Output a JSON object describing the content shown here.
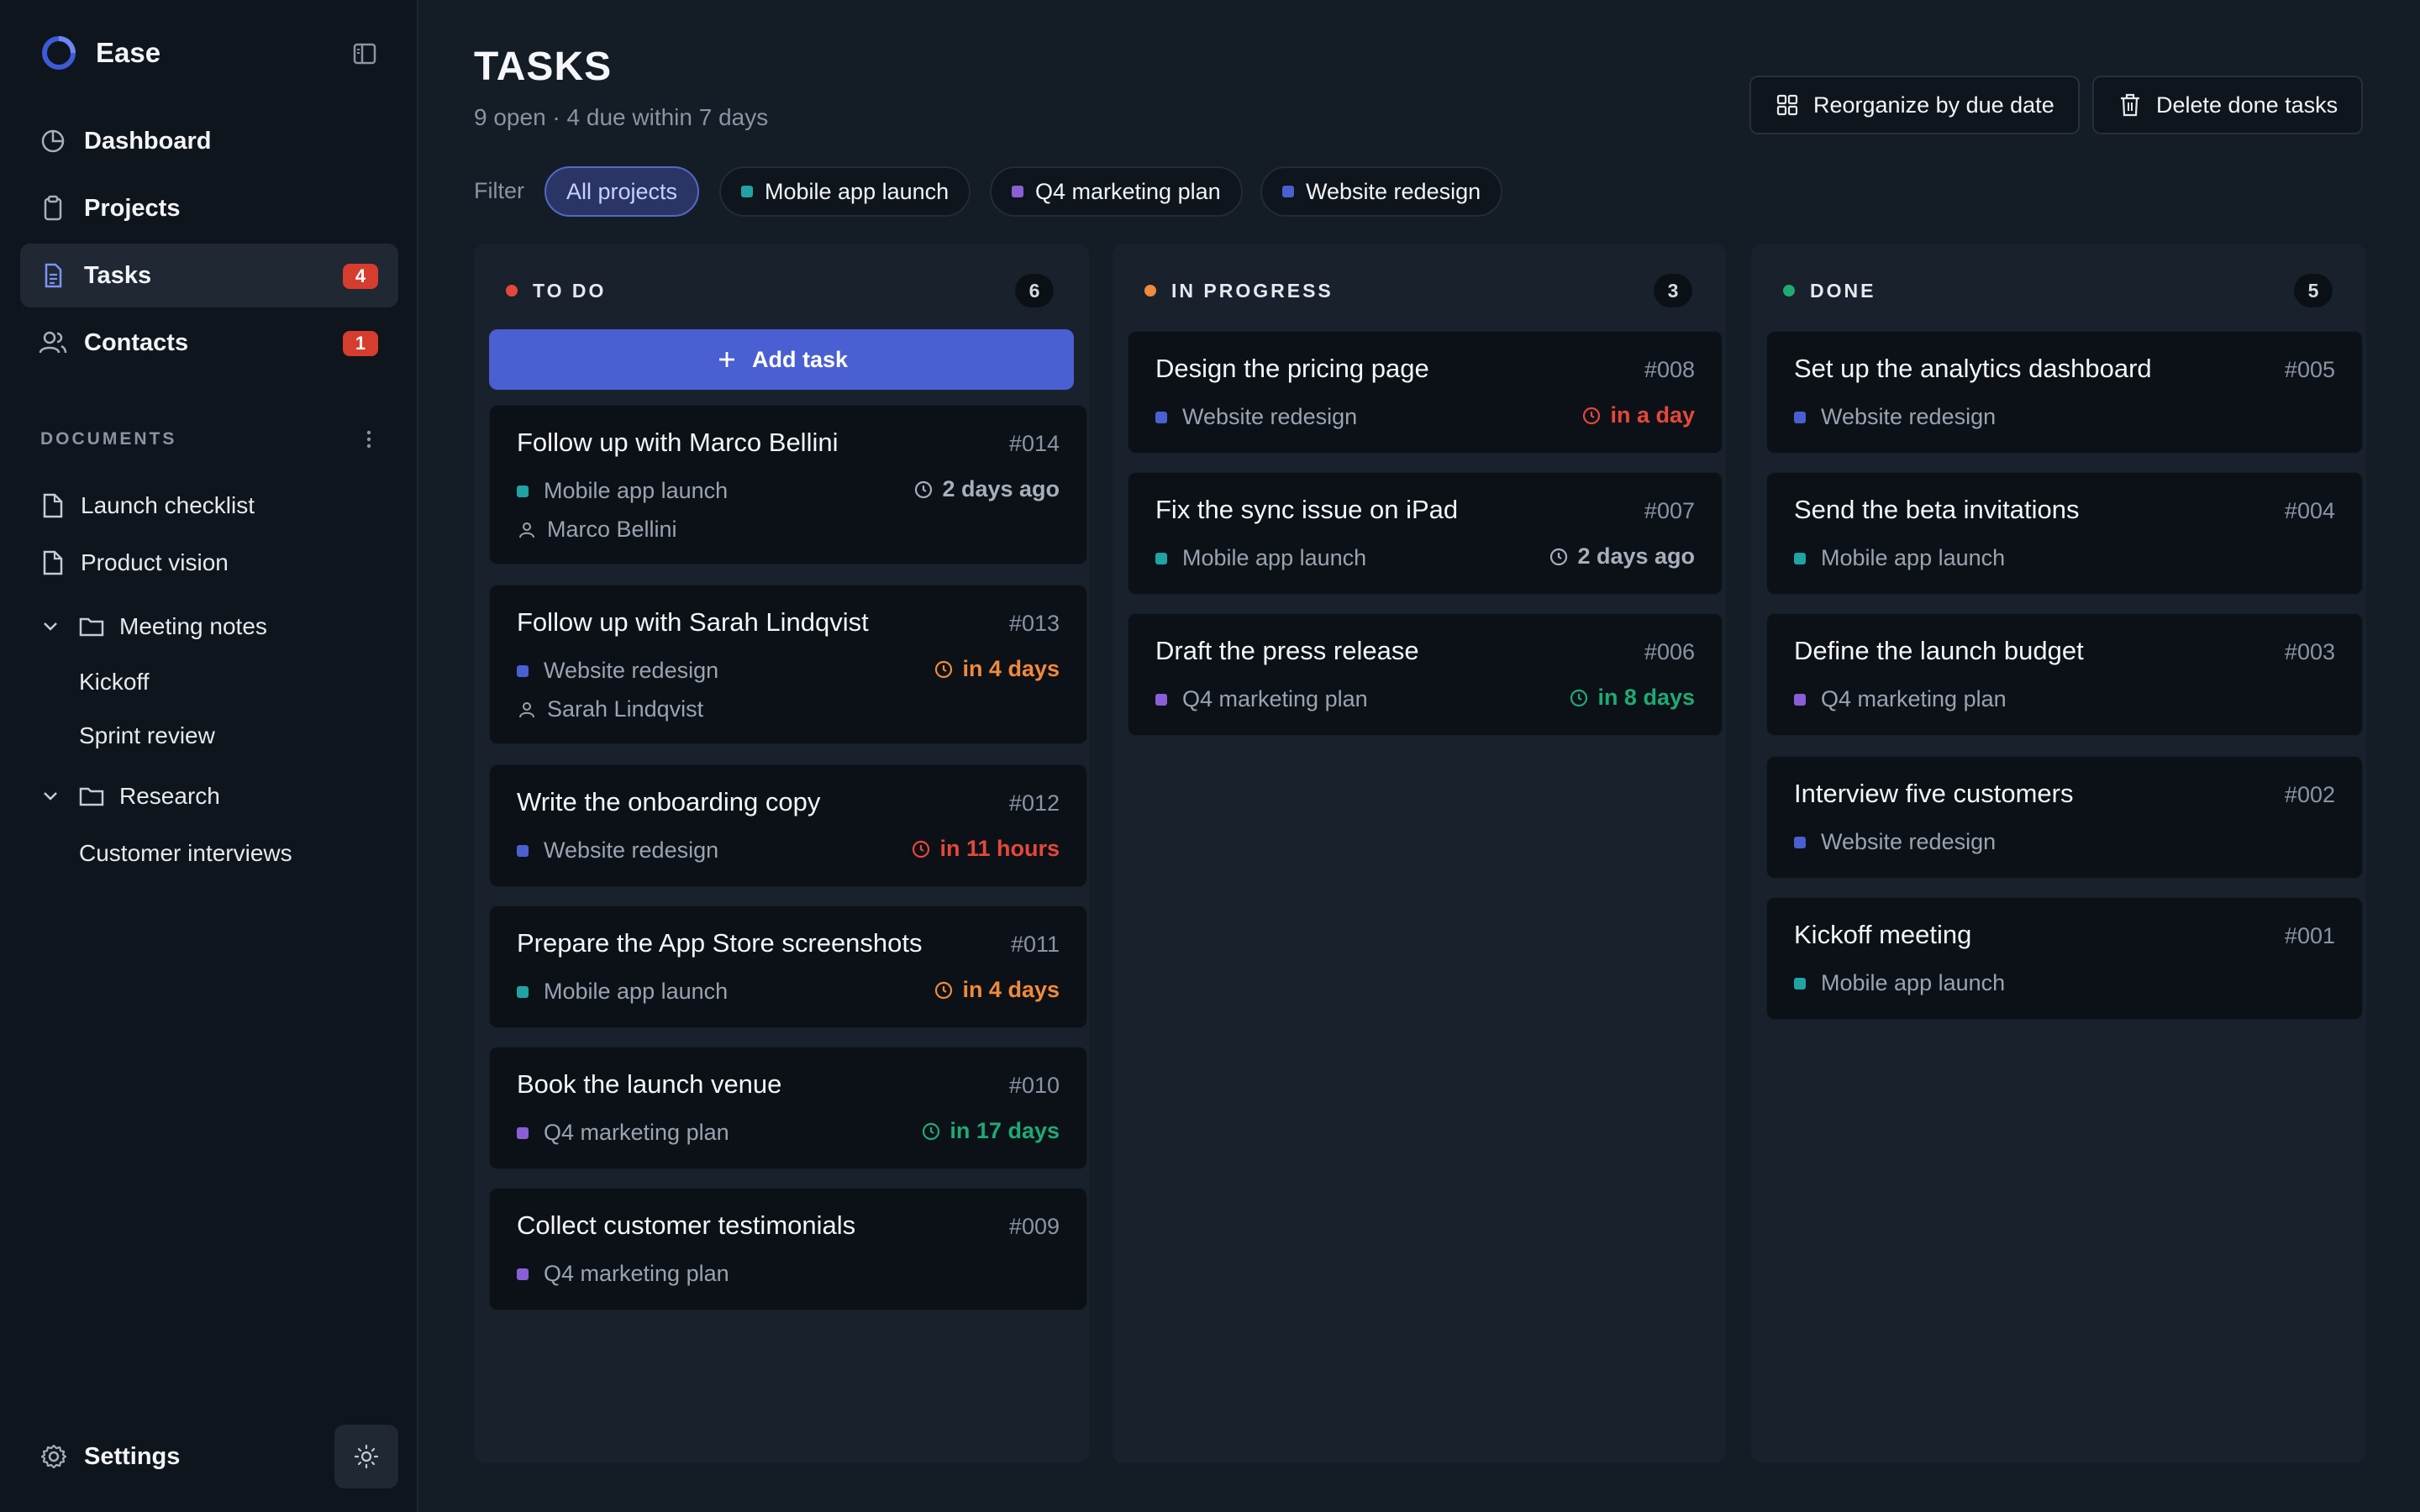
{
  "colors": {
    "teal": "#1fa3a3",
    "purple": "#8a5fd6",
    "blue": "#4a5fd1",
    "red": "#e5483a",
    "orange": "#f08a3c",
    "green": "#1faa74",
    "gray": "#a7afbb"
  },
  "sidebar": {
    "app_name": "Ease",
    "nav": [
      {
        "label": "Dashboard",
        "icon": "pie-chart-icon"
      },
      {
        "label": "Projects",
        "icon": "clipboard-icon"
      },
      {
        "label": "Tasks",
        "icon": "document-icon",
        "badge": "4",
        "active": true
      },
      {
        "label": "Contacts",
        "icon": "users-icon",
        "badge": "1"
      }
    ],
    "documents_heading": "DOCUMENTS",
    "documents": {
      "launch_checklist": "Launch checklist",
      "product_vision": "Product vision",
      "meeting_notes": "Meeting notes",
      "kickoff": "Kickoff",
      "sprint_review": "Sprint review",
      "research": "Research",
      "customer_interviews": "Customer interviews"
    },
    "settings_label": "Settings"
  },
  "header": {
    "title": "TASKS",
    "subtitle": "9 open · 4 due within 7 days",
    "reorganize_label": "Reorganize by due date",
    "delete_done_label": "Delete done tasks"
  },
  "filter": {
    "label": "Filter",
    "chips": [
      "All projects",
      "Mobile app launch",
      "Q4 marketing plan",
      "Website redesign"
    ]
  },
  "columns": {
    "todo": {
      "title": "TO DO",
      "count": "6",
      "add_label": "Add task",
      "cards": [
        {
          "title": "Follow up with Marco Bellini",
          "num": "#014",
          "project": "Mobile app launch",
          "due": "2 days ago",
          "contact": "Marco Bellini"
        },
        {
          "title": "Follow up with Sarah Lindqvist",
          "num": "#013",
          "project": "Website redesign",
          "due": "in 4 days",
          "contact": "Sarah Lindqvist"
        },
        {
          "title": "Write the onboarding copy",
          "num": "#012",
          "project": "Website redesign",
          "due": "in 11 hours"
        },
        {
          "title": "Prepare the App Store screenshots",
          "num": "#011",
          "project": "Mobile app launch",
          "due": "in 4 days"
        },
        {
          "title": "Book the launch venue",
          "num": "#010",
          "project": "Q4 marketing plan",
          "due": "in 17 days"
        },
        {
          "title": "Collect customer testimonials",
          "num": "#009",
          "project": "Q4 marketing plan"
        }
      ]
    },
    "inprogress": {
      "title": "IN PROGRESS",
      "count": "3",
      "cards": [
        {
          "title": "Design the pricing page",
          "num": "#008",
          "project": "Website redesign",
          "due": "in a day"
        },
        {
          "title": "Fix the sync issue on iPad",
          "num": "#007",
          "project": "Mobile app launch",
          "due": "2 days ago"
        },
        {
          "title": "Draft the press release",
          "num": "#006",
          "project": "Q4 marketing plan",
          "due": "in 8 days"
        }
      ]
    },
    "done": {
      "title": "DONE",
      "count": "5",
      "cards": [
        {
          "title": "Set up the analytics dashboard",
          "num": "#005",
          "project": "Website redesign"
        },
        {
          "title": "Send the beta invitations",
          "num": "#004",
          "project": "Mobile app launch"
        },
        {
          "title": "Define the launch budget",
          "num": "#003",
          "project": "Q4 marketing plan"
        },
        {
          "title": "Interview five customers",
          "num": "#002",
          "project": "Website redesign"
        },
        {
          "title": "Kickoff meeting",
          "num": "#001",
          "project": "Mobile app launch"
        }
      ]
    }
  }
}
